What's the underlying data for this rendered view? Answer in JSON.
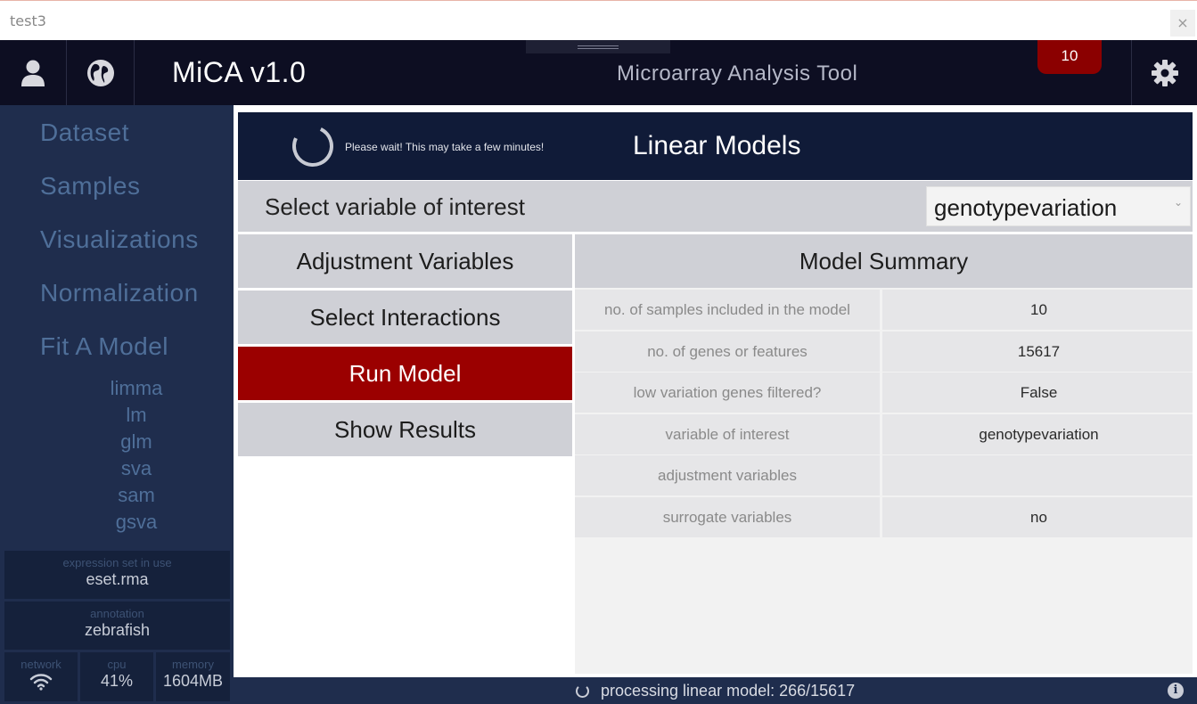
{
  "window": {
    "title": "test3",
    "close": "×"
  },
  "header": {
    "brand": "MiCA v1.0",
    "subtitle": "Microarray Analysis Tool",
    "notification_count": "10",
    "icons": {
      "user": "user-icon",
      "globe": "globe-icon",
      "settings": "gear-icon"
    }
  },
  "sidebar": {
    "nav": [
      "Dataset",
      "Samples",
      "Visualizations",
      "Normalization",
      "Fit A Model"
    ],
    "subnav": [
      "limma",
      "lm",
      "glm",
      "sva",
      "sam",
      "gsva"
    ],
    "expression": {
      "label": "expression set in use",
      "value": "eset.rma"
    },
    "annotation": {
      "label": "annotation",
      "value": "zebrafish"
    },
    "stats": {
      "network": {
        "label": "network",
        "icon": "wifi-icon"
      },
      "cpu": {
        "label": "cpu",
        "value": "41%"
      },
      "memory": {
        "label": "memory",
        "value": "1604MB"
      }
    }
  },
  "panel": {
    "wait_message": "Please wait! This may take a few minutes!",
    "title": "Linear Models",
    "variable_label": "Select variable of interest",
    "variable_value": "genotypevariation",
    "buttons": {
      "adjustment": "Adjustment Variables",
      "interactions": "Select Interactions",
      "run": "Run Model",
      "results": "Show Results"
    }
  },
  "summary": {
    "title": "Model Summary",
    "rows": [
      {
        "key": "no. of samples included in the model",
        "value": "10"
      },
      {
        "key": "no. of genes or features",
        "value": "15617"
      },
      {
        "key": "low variation genes filtered?",
        "value": "False"
      },
      {
        "key": "variable of interest",
        "value": "genotypevariation"
      },
      {
        "key": "adjustment variables",
        "value": ""
      },
      {
        "key": "surrogate variables",
        "value": "no"
      }
    ]
  },
  "status": {
    "text": "processing linear model: 266/15617",
    "info": "i"
  },
  "colors": {
    "accent": "#9b0000",
    "sidebar": "#1f2d4d",
    "header": "#0d0e22"
  }
}
